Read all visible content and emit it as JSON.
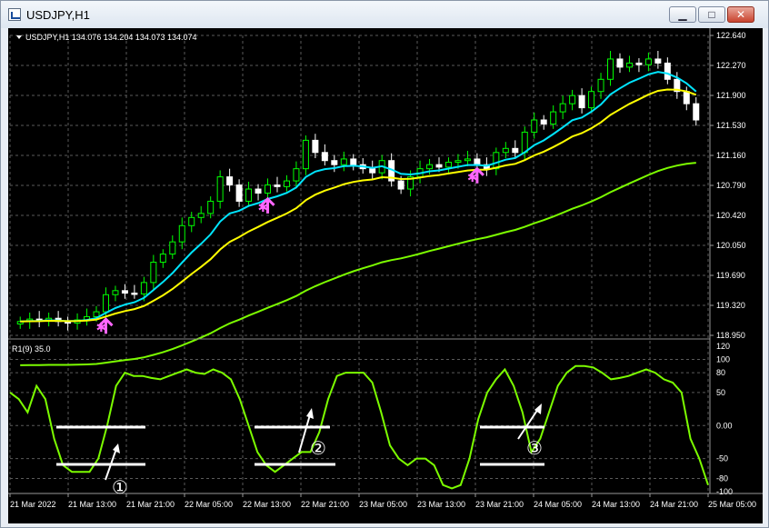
{
  "window": {
    "title": "USDJPY,H1",
    "controls": [
      "minimize",
      "restore",
      "close"
    ]
  },
  "main_chart": {
    "header": "USDJPY,H1  134.076 134.204 134.073 134.074",
    "price_labels": [
      "122.640",
      "122.270",
      "121.900",
      "121.530",
      "121.160",
      "120.790",
      "120.420",
      "120.050",
      "119.690",
      "119.320",
      "118.950"
    ]
  },
  "indicator": {
    "label": "R1(9) 35.0",
    "scale_labels": [
      "120",
      "100",
      "80",
      "50",
      "0.00",
      "-50",
      "-80",
      "-100"
    ],
    "markers": [
      "①",
      "②",
      "③"
    ]
  },
  "time_labels": [
    "21 Mar 2022",
    "21 Mar 13:00",
    "21 Mar 21:00",
    "22 Mar 05:00",
    "22 Mar 13:00",
    "22 Mar 21:00",
    "23 Mar 05:00",
    "23 Mar 13:00",
    "23 Mar 21:00",
    "24 Mar 05:00",
    "24 Mar 13:00",
    "24 Mar 21:00",
    "25 Mar 05:00"
  ],
  "colors": {
    "background": "#000000",
    "grid": "#5a5a5a",
    "candle_up": "#00ff00",
    "candle_down": "#ffffff",
    "ma_fast": "#00e5ff",
    "ma_mid": "#ffff00",
    "ma_slow": "#7cfc00",
    "oscillator": "#7cfc00",
    "arrow_signal": "#ff66ff"
  },
  "chart_data": {
    "type": "candlestick",
    "symbol": "USDJPY",
    "timeframe": "H1",
    "ylim": [
      118.95,
      122.64
    ],
    "close_series": [
      119.12,
      119.15,
      119.13,
      119.16,
      119.12,
      119.1,
      119.14,
      119.18,
      119.24,
      119.45,
      119.5,
      119.47,
      119.46,
      119.6,
      119.85,
      119.95,
      120.1,
      120.3,
      120.4,
      120.45,
      120.6,
      120.9,
      120.8,
      120.6,
      120.75,
      120.7,
      120.8,
      120.78,
      120.85,
      121.0,
      121.35,
      121.2,
      121.1,
      121.05,
      121.12,
      121.05,
      121.0,
      120.95,
      121.1,
      120.85,
      120.75,
      120.9,
      121.0,
      121.05,
      121.02,
      121.08,
      121.1,
      121.12,
      121.05,
      121.0,
      121.2,
      121.25,
      121.2,
      121.45,
      121.6,
      121.55,
      121.7,
      121.8,
      121.9,
      121.75,
      121.95,
      122.1,
      122.35,
      122.25,
      122.3,
      122.28,
      122.35,
      122.3,
      122.1,
      121.95,
      121.8,
      121.6
    ],
    "oscillator": {
      "name": "R1(9)",
      "ylim": [
        -100,
        120
      ],
      "values": [
        50,
        40,
        20,
        60,
        40,
        -20,
        -60,
        -70,
        -70,
        -70,
        -50,
        0,
        60,
        80,
        75,
        75,
        72,
        70,
        75,
        80,
        85,
        80,
        78,
        85,
        80,
        70,
        40,
        0,
        -40,
        -60,
        -70,
        -60,
        -50,
        -40,
        -40,
        -10,
        40,
        75,
        80,
        80,
        80,
        65,
        20,
        -30,
        -50,
        -60,
        -50,
        -50,
        -60,
        -90,
        -95,
        -90,
        -50,
        10,
        50,
        70,
        85,
        60,
        20,
        -40,
        -20,
        20,
        60,
        80,
        90,
        90,
        88,
        80,
        70,
        72,
        75,
        80,
        85,
        80,
        70,
        65,
        50,
        -20,
        -50,
        -90
      ]
    }
  }
}
